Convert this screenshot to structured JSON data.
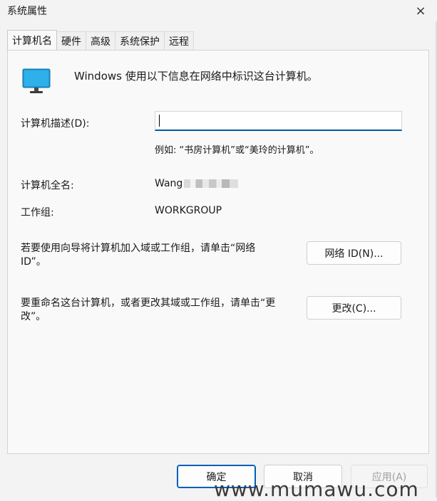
{
  "window": {
    "title": "系统属性",
    "close_icon": "×"
  },
  "tabs": [
    {
      "label": "计算机名",
      "active": true
    },
    {
      "label": "硬件"
    },
    {
      "label": "高级"
    },
    {
      "label": "系统保护"
    },
    {
      "label": "远程"
    }
  ],
  "main": {
    "intro": "Windows 使用以下信息在网络中标识这台计算机。",
    "description_label": "计算机描述(D):",
    "description_value": "",
    "example": "例如: “书房计算机”或“美玲的计算机”。",
    "full_name_label": "计算机全名:",
    "full_name_value": "Wang",
    "workgroup_label": "工作组:",
    "workgroup_value": "WORKGROUP",
    "network_id_text": "若要使用向导将计算机加入域或工作组，请单击“网络ID”。",
    "network_id_button": "网络 ID(N)...",
    "rename_text": "要重命名这台计算机，或者更改其域或工作组，请单击“更改”。",
    "change_button": "更改(C)..."
  },
  "footer": {
    "ok": "确定",
    "cancel": "取消",
    "apply": "应用(A)"
  },
  "watermark": "www.mumawu.com",
  "colors": {
    "accent": "#005fb8",
    "monitor": "#1e9bd7"
  }
}
